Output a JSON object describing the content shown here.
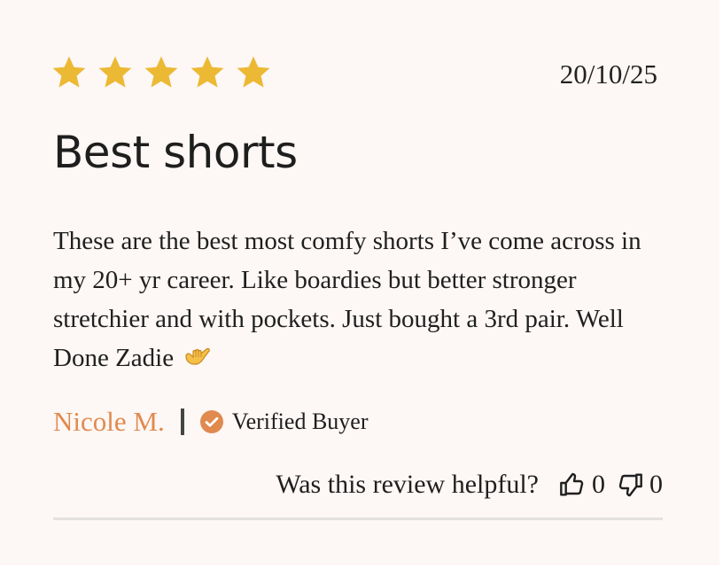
{
  "review": {
    "rating": 5,
    "rating_max": 5,
    "date": "20/10/25",
    "title": "Best shorts",
    "body": "These are the best most comfy shorts I’ve come across in my 20+ yr career. Like boardies but better stronger stretchier and with pockets. Just bought a 3rd pair. Well Done Zadie",
    "body_emoji": "call-me-hand-emoji",
    "author": "Nicole M.",
    "verified_label": "Verified Buyer",
    "helpful_question": "Was this review helpful?",
    "upvotes": "0",
    "downvotes": "0"
  },
  "colors": {
    "star": "#ecb935",
    "author": "#e08a4f",
    "verified_badge": "#e08a4f",
    "card_background": "#fdf7f5",
    "divider": "#e4e1df"
  },
  "icons": {
    "star": "star-icon",
    "verified": "check-circle-icon",
    "upvote": "thumbs-up-icon",
    "downvote": "thumbs-down-icon"
  }
}
